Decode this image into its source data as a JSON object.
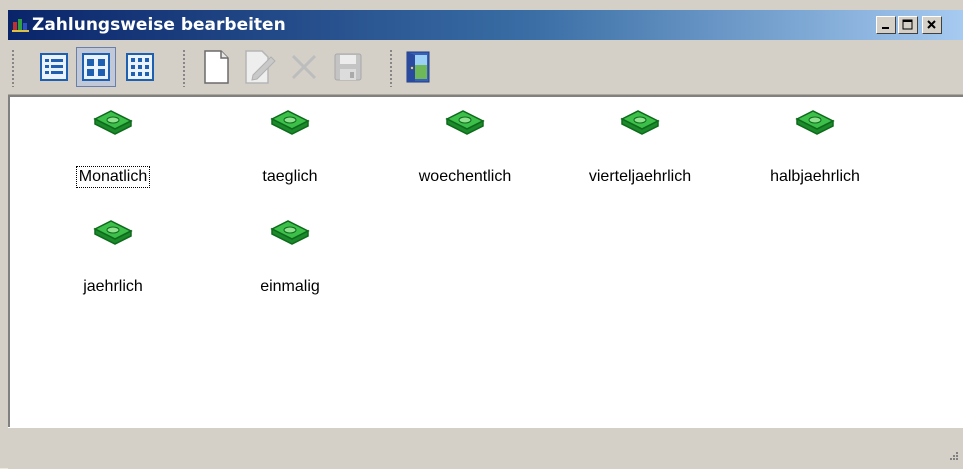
{
  "window": {
    "title": "Zahlungsweise bearbeiten",
    "controls": [
      "minimize-icon",
      "maximize-icon",
      "close-icon"
    ]
  },
  "toolbar": {
    "buttons": [
      {
        "name": "view-details",
        "icon": "details-view-icon",
        "active": false
      },
      {
        "name": "view-large-icons",
        "icon": "large-icons-view-icon",
        "active": true
      },
      {
        "name": "view-small-icons",
        "icon": "small-icons-view-icon",
        "active": false
      },
      {
        "name": "new",
        "icon": "new-document-icon",
        "enabled": true
      },
      {
        "name": "edit",
        "icon": "edit-icon",
        "enabled": false
      },
      {
        "name": "delete",
        "icon": "delete-icon",
        "enabled": false
      },
      {
        "name": "save",
        "icon": "save-icon",
        "enabled": false
      },
      {
        "name": "exit",
        "icon": "exit-door-icon",
        "enabled": true
      }
    ]
  },
  "items": [
    {
      "label": "Monatlich",
      "icon": "money-icon",
      "focused": true
    },
    {
      "label": "taeglich",
      "icon": "money-icon"
    },
    {
      "label": "woechentlich",
      "icon": "money-icon"
    },
    {
      "label": "vierteljaehrlich",
      "icon": "money-icon"
    },
    {
      "label": "halbjaehrlich",
      "icon": "money-icon"
    },
    {
      "label": "jaehrlich",
      "icon": "money-icon"
    },
    {
      "label": "einmalig",
      "icon": "money-icon"
    }
  ],
  "colors": {
    "title_start": "#0a246a",
    "title_end": "#a6caf0",
    "money_green": "#1f9a2e"
  }
}
